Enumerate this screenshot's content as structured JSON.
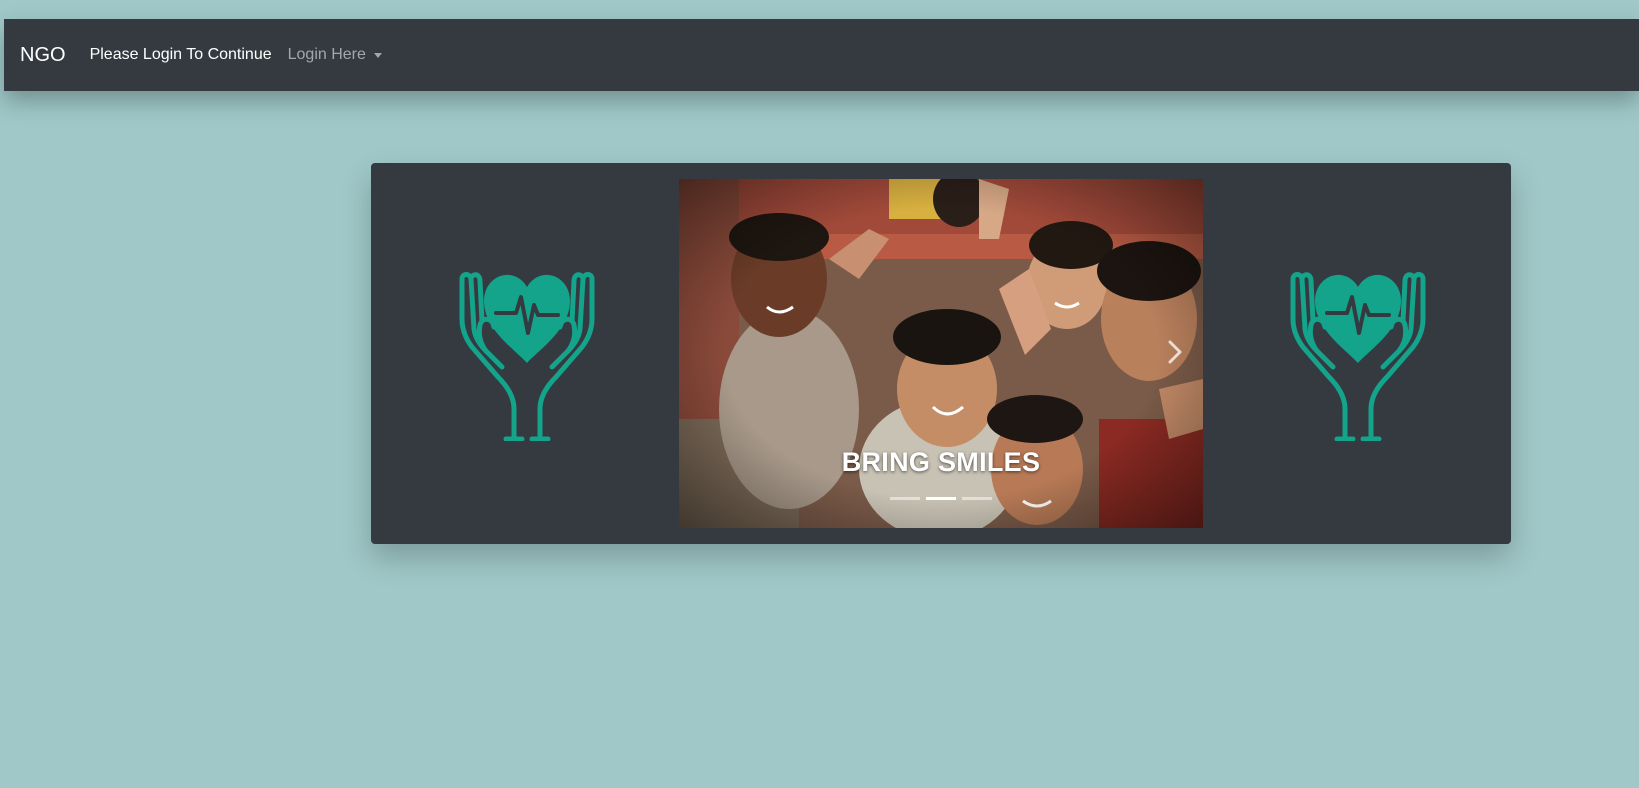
{
  "navbar": {
    "brand": "NGO",
    "message": "Please Login To Continue",
    "dropdown_label": "Login Here"
  },
  "carousel": {
    "caption": "BRING SMILES",
    "slide_count": 3,
    "active_slide": 2
  },
  "icons": {
    "logo_left": "hands-heart-icon",
    "logo_right": "hands-heart-icon",
    "next": "chevron-right-icon",
    "caret": "caret-down-icon"
  },
  "colors": {
    "background": "#a0c8c8",
    "navbar": "#343a40",
    "panel": "#343a40",
    "accent": "#14a38b"
  }
}
